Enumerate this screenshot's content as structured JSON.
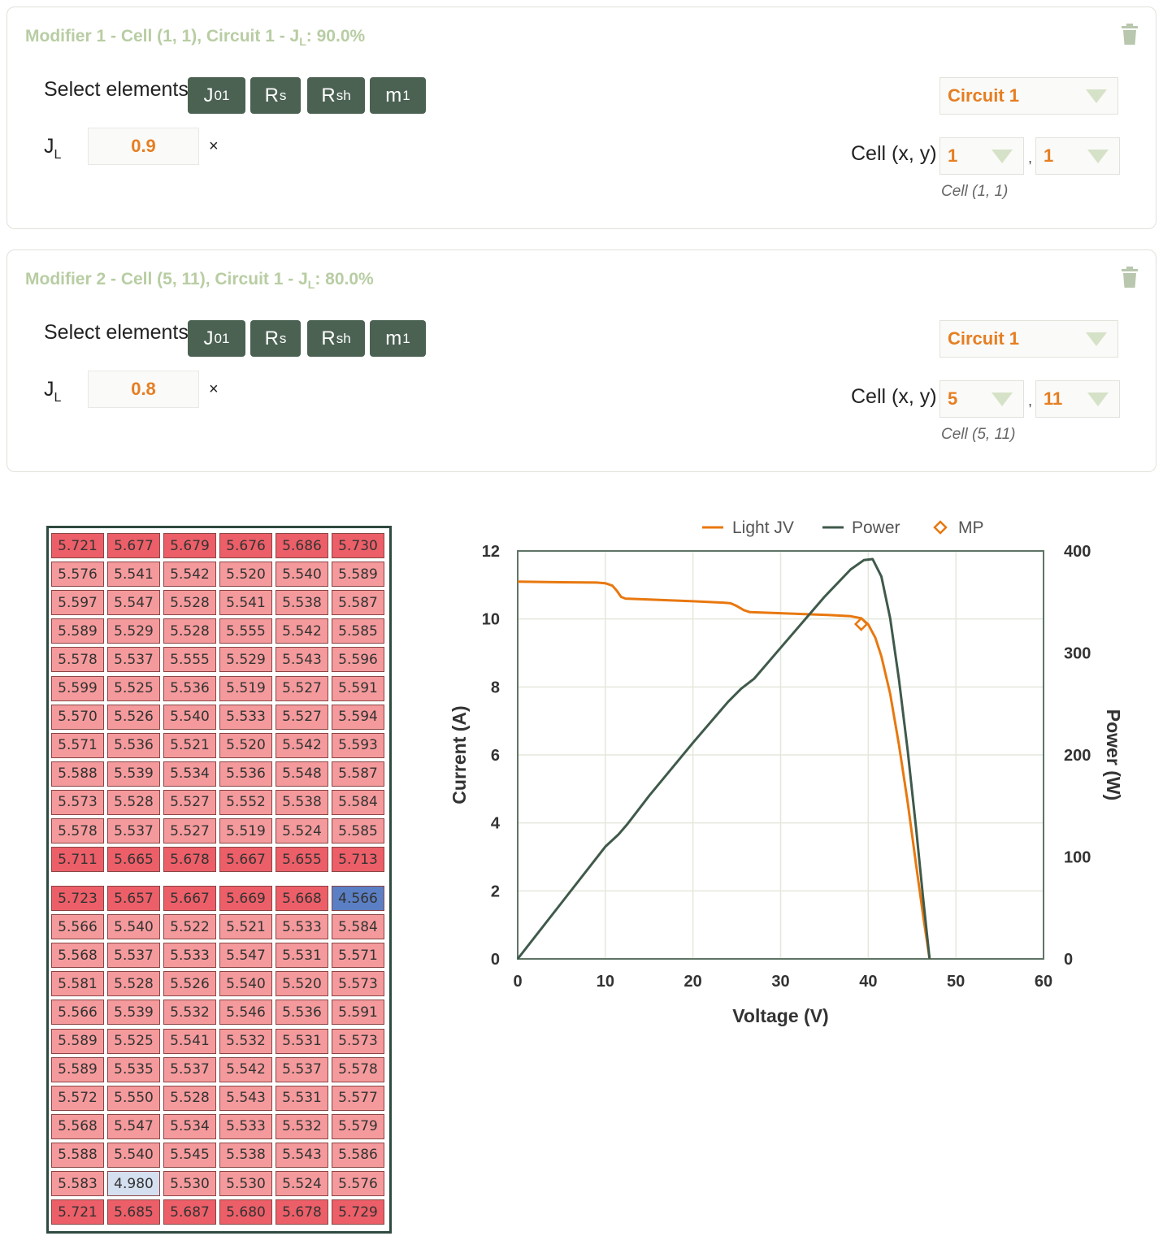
{
  "modifiers": [
    {
      "title_prefix": "Modifier 1 - Cell (1, 1), Circuit 1 - J",
      "title_sub": "L",
      "title_suffix": ": 90.0%",
      "select_label": "Select elements",
      "elements": [
        {
          "main": "J",
          "sub": "01"
        },
        {
          "main": "R",
          "sub": "s"
        },
        {
          "main": "R",
          "sub": "sh"
        },
        {
          "main": "m",
          "sub": "1"
        }
      ],
      "jl_label_main": "J",
      "jl_label_sub": "L",
      "jl_value": "0.9",
      "times": "×",
      "circuit": "Circuit 1",
      "cell_label": "Cell (x, y)",
      "cell_x": "1",
      "cell_y": "1",
      "comma": ",",
      "cell_hint": "Cell (1, 1)"
    },
    {
      "title_prefix": "Modifier 2 - Cell (5, 11), Circuit 1 - J",
      "title_sub": "L",
      "title_suffix": ": 80.0%",
      "select_label": "Select elements",
      "elements": [
        {
          "main": "J",
          "sub": "01"
        },
        {
          "main": "R",
          "sub": "s"
        },
        {
          "main": "R",
          "sub": "sh"
        },
        {
          "main": "m",
          "sub": "1"
        }
      ],
      "jl_label_main": "J",
      "jl_label_sub": "L",
      "jl_value": "0.8",
      "times": "×",
      "circuit": "Circuit 1",
      "cell_label": "Cell (x, y)",
      "cell_x": "5",
      "cell_y": "11",
      "comma": ",",
      "cell_hint": "Cell (5, 11)"
    }
  ],
  "grid": {
    "top": [
      [
        "5.721",
        "5.677",
        "5.679",
        "5.676",
        "5.686",
        "5.730"
      ],
      [
        "5.576",
        "5.541",
        "5.542",
        "5.520",
        "5.540",
        "5.589"
      ],
      [
        "5.597",
        "5.547",
        "5.528",
        "5.541",
        "5.538",
        "5.587"
      ],
      [
        "5.589",
        "5.529",
        "5.528",
        "5.555",
        "5.542",
        "5.585"
      ],
      [
        "5.578",
        "5.537",
        "5.555",
        "5.529",
        "5.543",
        "5.596"
      ],
      [
        "5.599",
        "5.525",
        "5.536",
        "5.519",
        "5.527",
        "5.591"
      ],
      [
        "5.570",
        "5.526",
        "5.540",
        "5.533",
        "5.527",
        "5.594"
      ],
      [
        "5.571",
        "5.536",
        "5.521",
        "5.520",
        "5.542",
        "5.593"
      ],
      [
        "5.588",
        "5.539",
        "5.534",
        "5.536",
        "5.548",
        "5.587"
      ],
      [
        "5.573",
        "5.528",
        "5.527",
        "5.552",
        "5.538",
        "5.584"
      ],
      [
        "5.578",
        "5.537",
        "5.527",
        "5.519",
        "5.524",
        "5.585"
      ],
      [
        "5.711",
        "5.665",
        "5.678",
        "5.667",
        "5.655",
        "5.713"
      ]
    ],
    "bottom": [
      [
        "5.723",
        "5.657",
        "5.667",
        "5.669",
        "5.668",
        "4.566"
      ],
      [
        "5.566",
        "5.540",
        "5.522",
        "5.521",
        "5.533",
        "5.584"
      ],
      [
        "5.568",
        "5.537",
        "5.533",
        "5.547",
        "5.531",
        "5.571"
      ],
      [
        "5.581",
        "5.528",
        "5.526",
        "5.540",
        "5.520",
        "5.573"
      ],
      [
        "5.566",
        "5.539",
        "5.532",
        "5.546",
        "5.536",
        "5.591"
      ],
      [
        "5.589",
        "5.525",
        "5.541",
        "5.532",
        "5.531",
        "5.573"
      ],
      [
        "5.589",
        "5.535",
        "5.537",
        "5.542",
        "5.537",
        "5.578"
      ],
      [
        "5.572",
        "5.550",
        "5.528",
        "5.543",
        "5.531",
        "5.577"
      ],
      [
        "5.568",
        "5.547",
        "5.534",
        "5.533",
        "5.532",
        "5.579"
      ],
      [
        "5.588",
        "5.540",
        "5.545",
        "5.538",
        "5.543",
        "5.586"
      ],
      [
        "5.583",
        "4.980",
        "5.530",
        "5.530",
        "5.524",
        "5.576"
      ],
      [
        "5.721",
        "5.685",
        "5.687",
        "5.680",
        "5.678",
        "5.729"
      ]
    ],
    "colors": {
      "strong_red": "#ec5f68",
      "light_red": "#f59a9c",
      "blue": "#5b7fc4",
      "light_blue": "#d4e0ef"
    }
  },
  "chart_data": {
    "type": "line",
    "xlabel": "Voltage (V)",
    "ylabel": "Current (A)",
    "y2label": "Power (W)",
    "xlim": [
      0,
      60
    ],
    "ylim": [
      0,
      12
    ],
    "y2lim": [
      0,
      400
    ],
    "xticks": [
      "0",
      "10",
      "20",
      "30",
      "40",
      "50",
      "60"
    ],
    "yticks": [
      "0",
      "2",
      "4",
      "6",
      "8",
      "10",
      "12"
    ],
    "y2ticks": [
      "0",
      "100",
      "200",
      "300",
      "400"
    ],
    "legend": [
      "Light JV",
      "Power",
      "MP"
    ],
    "legend_position": "top",
    "grid": true,
    "colors": {
      "light_jv": "#e8780f",
      "power": "#3f5a4b",
      "mp": "#e8780f"
    },
    "series": [
      {
        "name": "Light JV",
        "axis": "left",
        "x": [
          0,
          5,
          9,
          10,
          10.8,
          11.3,
          11.8,
          12.3,
          15,
          20,
          23.5,
          24.3,
          25,
          25.8,
          26.5,
          30,
          35,
          38,
          39.2,
          40,
          40.8,
          41.5,
          42.5,
          43.5,
          44.5,
          45.5,
          46.3,
          47
        ],
        "y": [
          11.1,
          11.08,
          11.07,
          11.05,
          10.98,
          10.83,
          10.65,
          10.6,
          10.57,
          10.52,
          10.48,
          10.46,
          10.38,
          10.26,
          10.2,
          10.17,
          10.12,
          10.08,
          10.02,
          9.84,
          9.45,
          8.9,
          7.8,
          6.3,
          4.6,
          2.7,
          1.2,
          0
        ]
      },
      {
        "name": "Power",
        "axis": "right",
        "x": [
          0,
          5,
          10,
          11.5,
          12.5,
          15,
          20,
          24,
          25.5,
          27,
          30,
          35,
          38,
          39.5,
          40.5,
          41.5,
          42.5,
          43.5,
          44.5,
          45.5,
          46.3,
          47
        ],
        "y": [
          0,
          55,
          110,
          122,
          132,
          160,
          212,
          252,
          265,
          275,
          305,
          355,
          382,
          391,
          392,
          375,
          334,
          274,
          204,
          125,
          56,
          0
        ]
      },
      {
        "name": "MP",
        "axis": "left",
        "x": [
          39.2
        ],
        "y": [
          9.85
        ]
      }
    ]
  }
}
